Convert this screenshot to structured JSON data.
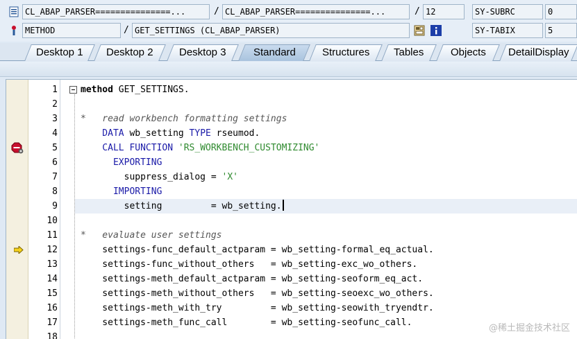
{
  "header": {
    "program_field": "CL_ABAP_PARSER===============...",
    "include_field": "CL_ABAP_PARSER===============...",
    "line_field": "12",
    "sy_subrc_label": "SY-SUBRC",
    "sy_subrc_value": "0",
    "event_type_field": "METHOD",
    "event_name_field": "GET_SETTINGS (CL_ABAP_PARSER)",
    "sy_tabix_label": "SY-TABIX",
    "sy_tabix_value": "5",
    "slash": "/"
  },
  "tabs": [
    {
      "label": "Desktop 1"
    },
    {
      "label": "Desktop 2"
    },
    {
      "label": "Desktop 3"
    },
    {
      "label": "Standard",
      "active": true
    },
    {
      "label": "Structures"
    },
    {
      "label": "Tables"
    },
    {
      "label": "Objects"
    },
    {
      "label": "DetailDisplay"
    }
  ],
  "code": {
    "lines": [
      {
        "no": "1",
        "t1": "method",
        "t2": " GET_SETTINGS."
      },
      {
        "no": "2"
      },
      {
        "no": "3",
        "comment": "*   read workbench formatting settings"
      },
      {
        "no": "4",
        "t1": "    DATA",
        "t2": " wb_setting ",
        "t3": "TYPE",
        "t4": " rseumod."
      },
      {
        "no": "5",
        "t1": "    CALL FUNCTION",
        "t2": " ",
        "t3": "'RS_WORKBENCH_CUSTOMIZING'"
      },
      {
        "no": "6",
        "t1": "      EXPORTING"
      },
      {
        "no": "7",
        "t1": "        suppress_dialog = ",
        "t2": "'X'"
      },
      {
        "no": "8",
        "t1": "      IMPORTING"
      },
      {
        "no": "9",
        "t1": "        setting         = wb_setting."
      },
      {
        "no": "10"
      },
      {
        "no": "11",
        "comment": "*   evaluate user settings"
      },
      {
        "no": "12",
        "t1": "    settings-func_default_actparam = wb_setting-formal_eq_actual."
      },
      {
        "no": "13",
        "t1": "    settings-func_without_others   = wb_setting-exc_wo_others."
      },
      {
        "no": "14",
        "t1": "    settings-meth_default_actparam = wb_setting-seoform_eq_act."
      },
      {
        "no": "15",
        "t1": "    settings-meth_without_others   = wb_setting-seoexc_wo_others."
      },
      {
        "no": "16",
        "t1": "    settings-meth_with_try         = wb_setting-seowith_tryendtr."
      },
      {
        "no": "17",
        "t1": "    settings-meth_func_call        = wb_setting-seofunc_call."
      },
      {
        "no": "18"
      }
    ]
  },
  "watermark": "@稀土掘金技术社区"
}
